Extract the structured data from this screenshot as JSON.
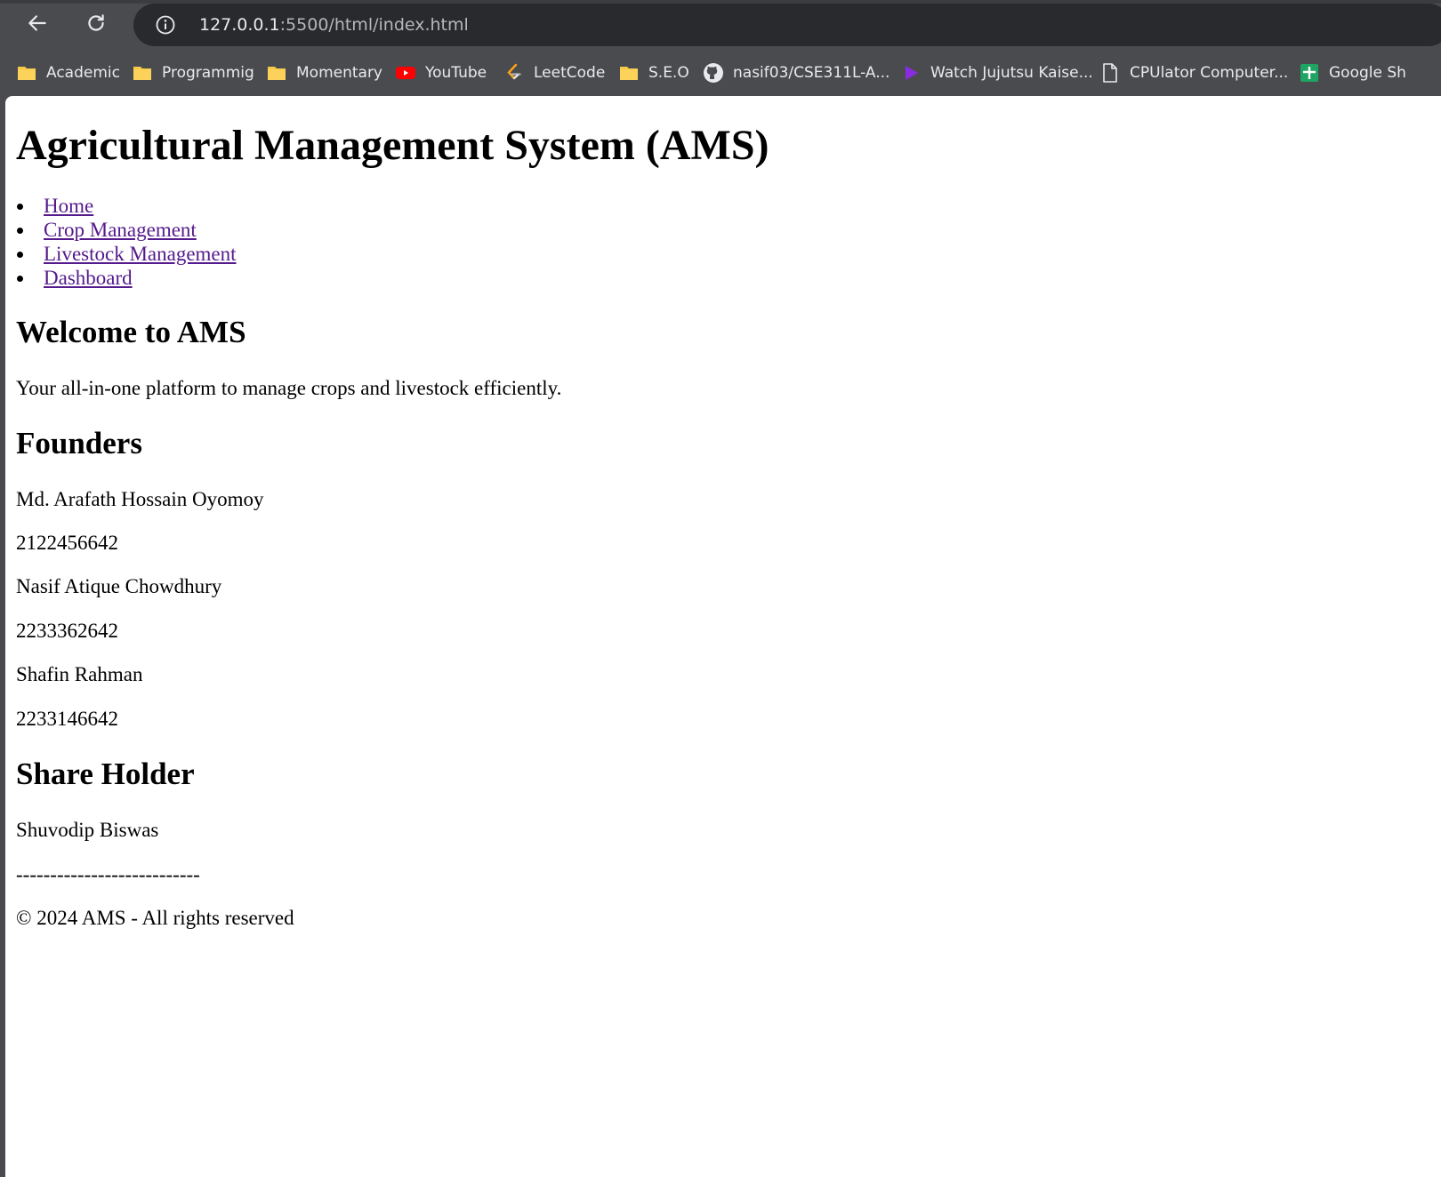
{
  "browser": {
    "url_host": "127.0.0.1",
    "url_path": ":5500/html/index.html",
    "bookmarks": [
      {
        "label": "Academic",
        "icon": "folder-icon"
      },
      {
        "label": "Programmig",
        "icon": "folder-icon"
      },
      {
        "label": "Momentary",
        "icon": "folder-icon"
      },
      {
        "label": "YouTube",
        "icon": "youtube-icon"
      },
      {
        "label": "LeetCode",
        "icon": "leetcode-icon"
      },
      {
        "label": "S.E.O",
        "icon": "folder-icon"
      },
      {
        "label": "nasif03/CSE311L-A...",
        "icon": "github-icon"
      },
      {
        "label": "Watch Jujutsu Kaise...",
        "icon": "play-icon"
      },
      {
        "label": "CPUlator Computer...",
        "icon": "document-icon"
      },
      {
        "label": "Google Sh",
        "icon": "google-sheets-icon"
      }
    ]
  },
  "page": {
    "title": "Agricultural Management System (AMS)",
    "nav": [
      "Home",
      "Crop Management",
      "Livestock Management",
      "Dashboard"
    ],
    "welcome_heading": "Welcome to AMS",
    "welcome_text": "Your all-in-one platform to manage crops and livestock efficiently.",
    "founders_heading": "Founders",
    "founders": [
      {
        "name": "Md. Arafath Hossain Oyomoy",
        "id": "2122456642"
      },
      {
        "name": "Nasif Atique Chowdhury",
        "id": "2233362642"
      },
      {
        "name": "Shafin Rahman",
        "id": "2233146642"
      }
    ],
    "share_holder_heading": "Share Holder",
    "share_holder": "Shuvodip Biswas",
    "divider": "---------------------------",
    "footer": "© 2024 AMS - All rights reserved"
  },
  "colors": {
    "chrome": "#4a4b4f",
    "omnibox": "#282a2d",
    "visited_link": "#551a8b"
  }
}
